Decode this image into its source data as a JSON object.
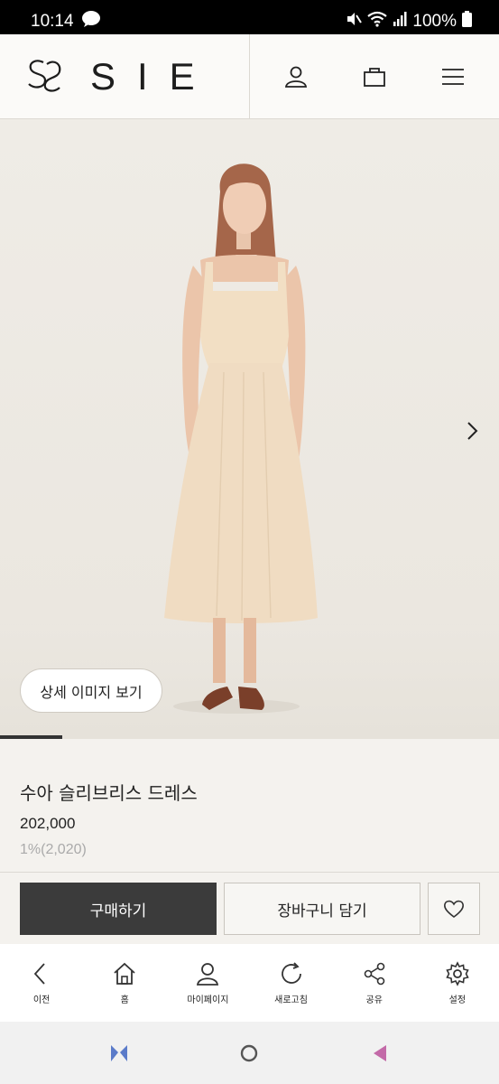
{
  "status_bar": {
    "time": "10:14",
    "battery": "100%"
  },
  "header": {
    "brand": "SIE",
    "icons": [
      "user-icon",
      "bag-icon",
      "menu-icon"
    ]
  },
  "hero": {
    "detail_button": "상세 이미지 보기",
    "image_progress": 0.125
  },
  "product": {
    "name": "수아 슬리브리스 드레스",
    "price": "202,000",
    "points": "1%(2,020)"
  },
  "actions": {
    "buy": "구매하기",
    "cart": "장바구니 담기"
  },
  "app_nav": {
    "items": [
      {
        "label": "이전",
        "icon": "back-icon"
      },
      {
        "label": "홈",
        "icon": "home-icon"
      },
      {
        "label": "마이페이지",
        "icon": "person-icon"
      },
      {
        "label": "새로고침",
        "icon": "refresh-icon"
      },
      {
        "label": "공유",
        "icon": "share-icon"
      },
      {
        "label": "설정",
        "icon": "settings-icon"
      }
    ]
  },
  "colors": {
    "accent_dark": "#3b3b3b",
    "background": "#f4f2ee",
    "dress": "#f0dcc2"
  }
}
